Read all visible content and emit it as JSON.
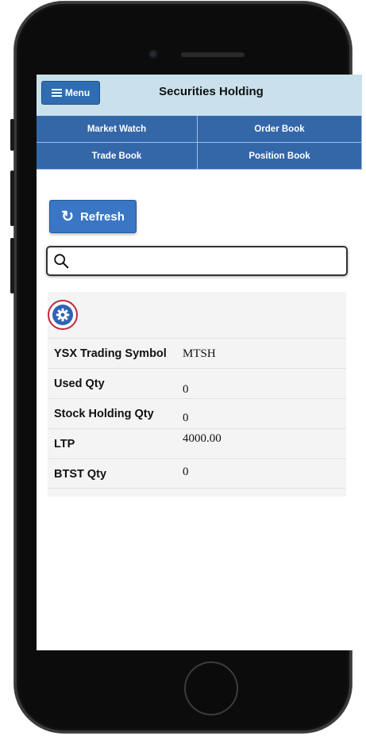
{
  "header": {
    "menu_label": "Menu",
    "title": "Securities Holding"
  },
  "nav": {
    "items": [
      "Market Watch",
      "Order Book",
      "Trade Book",
      "Position Book"
    ]
  },
  "refresh": {
    "label": "Refresh",
    "icon": "refresh-icon"
  },
  "search": {
    "value": "",
    "placeholder": "",
    "icon": "search-icon"
  },
  "settings": {
    "icon": "gear-icon"
  },
  "holding": {
    "rows": [
      {
        "label": "YSX Trading Symbol",
        "value": "MTSH"
      },
      {
        "label": "Used Qty",
        "value": "0"
      },
      {
        "label": "Stock Holding Qty",
        "value": "0"
      },
      {
        "label": "LTP",
        "value": "4000.00"
      },
      {
        "label": "BTST Qty",
        "value": "0"
      }
    ]
  },
  "colors": {
    "header_bg": "#c9e1ec",
    "nav_bg": "#3467a8",
    "button_bg": "#3a76c4",
    "highlight_ring": "#c0293b"
  }
}
